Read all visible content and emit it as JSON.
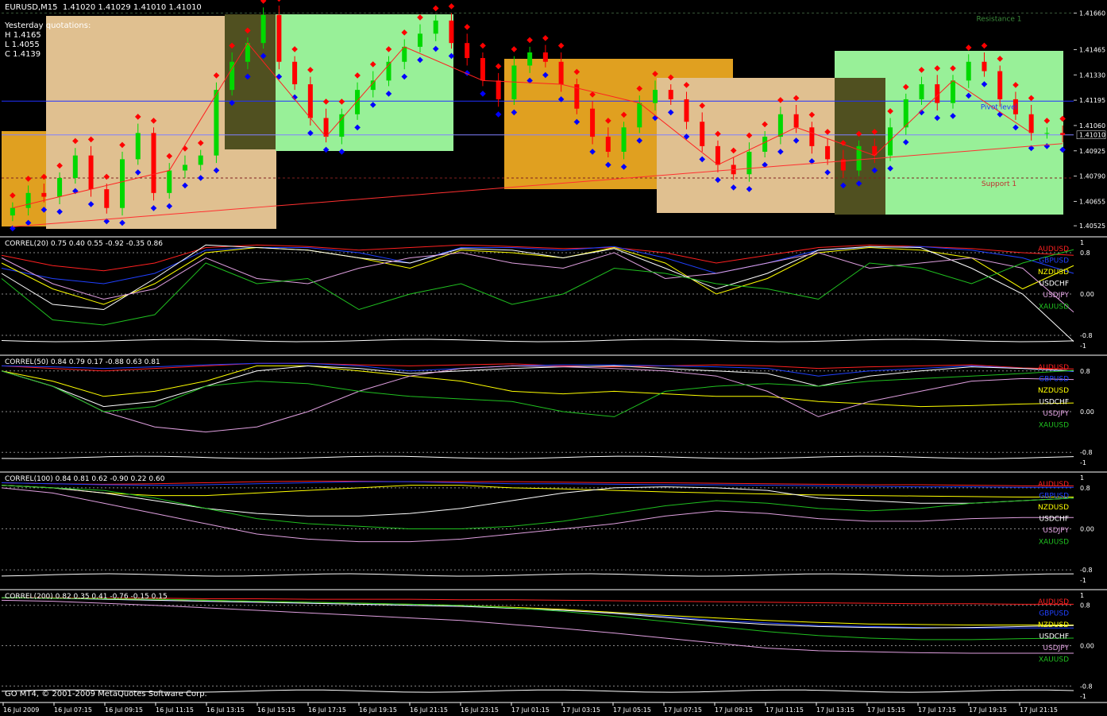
{
  "header": {
    "symbol_line": "EURUSD,M15  1.41020 1.41029 1.41010 1.41010",
    "yesterday_title": "Yesterday quotations:",
    "high": "H 1.4165",
    "low": "L 1.4055",
    "close": "C 1.4139"
  },
  "copyright": "GO MT4, © 2001-2009 MetaQuotes Software Corp.",
  "colors": {
    "background": "#000000",
    "bull": "#00d800",
    "bear": "#ff0000",
    "resistance_dots": "#ff0000",
    "support_dots": "#0000ff",
    "box_tan": "#e0c090",
    "box_green": "#98f098",
    "box_orange": "#e0a020",
    "box_blue": "#0018b0",
    "box_olive": "#505020",
    "AUDUSD": "#ff2020",
    "GBPUSD": "#2040ff",
    "NZDUSD": "#ffff00",
    "USDCHF": "#ffffff",
    "USDJPY": "#e0a0e0",
    "XAUUSD": "#20c020"
  },
  "time_axis": [
    "16 Jul 2009",
    "16 Jul 07:15",
    "16 Jul 09:15",
    "16 Jul 11:15",
    "16 Jul 13:15",
    "16 Jul 15:15",
    "16 Jul 17:15",
    "16 Jul 19:15",
    "16 Jul 21:15",
    "16 Jul 23:15",
    "17 Jul 01:15",
    "17 Jul 03:15",
    "17 Jul 05:15",
    "17 Jul 07:15",
    "17 Jul 09:15",
    "17 Jul 11:15",
    "17 Jul 13:15",
    "17 Jul 15:15",
    "17 Jul 17:15",
    "17 Jul 19:15",
    "17 Jul 21:15"
  ],
  "chart_data": [
    {
      "type": "candlestick",
      "title": "EURUSD,M15",
      "yaxis_ticks": [
        "1.41660",
        "1.41465",
        "1.41330",
        "1.41195",
        "1.41060",
        "1.40925",
        "1.40790",
        "1.40655",
        "1.40525"
      ],
      "ylim": [
        1.405,
        1.417
      ],
      "current_price": "1.41010",
      "annotations": [
        "Resistance 1",
        "Pivot level",
        "Support 1"
      ],
      "levels": {
        "resistance_1": 1.4166,
        "pivot": 1.4119,
        "support_1": 1.4078
      },
      "close_path": [
        1.4062,
        1.407,
        1.4068,
        1.4078,
        1.409,
        1.4072,
        1.4062,
        1.4088,
        1.4102,
        1.407,
        1.4082,
        1.4085,
        1.409,
        1.4125,
        1.414,
        1.415,
        1.4165,
        1.414,
        1.4128,
        1.411,
        1.41,
        1.4112,
        1.4125,
        1.413,
        1.414,
        1.4148,
        1.4155,
        1.4162,
        1.415,
        1.4142,
        1.413,
        1.412,
        1.4138,
        1.4145,
        1.414,
        1.4128,
        1.4115,
        1.41,
        1.4092,
        1.4105,
        1.4118,
        1.4125,
        1.412,
        1.4108,
        1.4095,
        1.4085,
        1.408,
        1.4092,
        1.41,
        1.4112,
        1.4105,
        1.4095,
        1.4088,
        1.4082,
        1.4095,
        1.409,
        1.4105,
        1.412,
        1.4128,
        1.4118,
        1.413,
        1.414,
        1.4135,
        1.412,
        1.4112,
        1.4102,
        1.4102,
        1.4101
      ]
    },
    {
      "type": "line",
      "title": "CORREL(20) 0.75 0.40 0.55 -0.92 -0.35 0.86",
      "period": 20,
      "yaxis_ticks": [
        "1",
        "0.8",
        "0.00",
        "-0.8",
        "-1"
      ],
      "ylim": [
        -1,
        1
      ],
      "series": [
        {
          "name": "AUDUSD",
          "values": [
            0.75,
            0.55,
            0.45,
            0.6,
            0.9,
            0.95,
            0.92,
            0.85,
            0.9,
            0.95,
            0.92,
            0.88,
            0.9,
            0.8,
            0.6,
            0.75,
            0.9,
            0.95,
            0.92,
            0.88,
            0.8,
            0.75
          ]
        },
        {
          "name": "GBPUSD",
          "values": [
            0.5,
            0.3,
            0.2,
            0.4,
            0.85,
            0.9,
            0.9,
            0.8,
            0.6,
            0.9,
            0.9,
            0.85,
            0.92,
            0.7,
            0.4,
            0.6,
            0.85,
            0.9,
            0.92,
            0.85,
            0.7,
            0.4
          ]
        },
        {
          "name": "NZDUSD",
          "values": [
            0.6,
            0.1,
            -0.2,
            0.2,
            0.8,
            0.9,
            0.85,
            0.7,
            0.5,
            0.85,
            0.8,
            0.7,
            0.9,
            0.6,
            0.0,
            0.3,
            0.8,
            0.9,
            0.85,
            0.7,
            0.1,
            0.55
          ]
        },
        {
          "name": "USDCHF",
          "values": [
            0.4,
            -0.2,
            -0.3,
            0.3,
            0.95,
            0.9,
            0.85,
            0.7,
            0.6,
            0.88,
            0.85,
            0.7,
            0.88,
            0.5,
            0.1,
            0.4,
            0.85,
            0.92,
            0.9,
            0.5,
            0.0,
            -0.92
          ]
        },
        {
          "name": "USDJPY",
          "values": [
            0.7,
            0.2,
            -0.1,
            0.1,
            0.7,
            0.3,
            0.2,
            0.5,
            0.7,
            0.8,
            0.6,
            0.5,
            0.8,
            0.3,
            0.4,
            0.6,
            0.8,
            0.5,
            0.6,
            0.7,
            0.5,
            -0.35
          ]
        },
        {
          "name": "XAUUSD",
          "values": [
            0.3,
            -0.5,
            -0.6,
            -0.4,
            0.6,
            0.2,
            0.3,
            -0.3,
            0.0,
            0.2,
            -0.2,
            0.0,
            0.5,
            0.4,
            0.2,
            0.1,
            -0.1,
            0.6,
            0.5,
            0.2,
            0.6,
            0.86
          ]
        }
      ]
    },
    {
      "type": "line",
      "title": "CORREL(50) 0.84 0.79 0.17 -0.88 0.63 0.81",
      "period": 50,
      "yaxis_ticks": [
        "0.8",
        "0.00",
        "-0.8",
        "-1"
      ],
      "ylim": [
        -1,
        1
      ],
      "series": [
        {
          "name": "AUDUSD",
          "values": [
            0.9,
            0.85,
            0.8,
            0.85,
            0.9,
            0.95,
            0.95,
            0.92,
            0.9,
            0.92,
            0.94,
            0.9,
            0.88,
            0.9,
            0.92,
            0.9,
            0.85,
            0.88,
            0.9,
            0.92,
            0.86,
            0.84
          ]
        },
        {
          "name": "GBPUSD",
          "values": [
            0.9,
            0.88,
            0.85,
            0.88,
            0.92,
            0.95,
            0.95,
            0.9,
            0.8,
            0.85,
            0.9,
            0.92,
            0.92,
            0.9,
            0.88,
            0.85,
            0.7,
            0.8,
            0.85,
            0.9,
            0.85,
            0.79
          ]
        },
        {
          "name": "NZDUSD",
          "values": [
            0.8,
            0.6,
            0.3,
            0.4,
            0.6,
            0.9,
            0.9,
            0.8,
            0.7,
            0.6,
            0.4,
            0.35,
            0.4,
            0.35,
            0.3,
            0.3,
            0.2,
            0.15,
            0.1,
            0.12,
            0.15,
            0.17
          ]
        },
        {
          "name": "USDCHF",
          "values": [
            0.8,
            0.5,
            0.1,
            0.2,
            0.5,
            0.8,
            0.9,
            0.85,
            0.75,
            0.8,
            0.85,
            0.88,
            0.9,
            0.85,
            0.8,
            0.75,
            0.5,
            0.7,
            0.8,
            0.88,
            0.85,
            0.8
          ]
        },
        {
          "name": "USDJPY",
          "values": [
            0.8,
            0.5,
            0.0,
            -0.3,
            -0.4,
            -0.3,
            0.0,
            0.4,
            0.7,
            0.85,
            0.9,
            0.88,
            0.85,
            0.8,
            0.7,
            0.4,
            -0.1,
            0.2,
            0.4,
            0.6,
            0.65,
            0.63
          ]
        },
        {
          "name": "XAUUSD",
          "values": [
            0.8,
            0.5,
            0.0,
            0.1,
            0.5,
            0.6,
            0.55,
            0.4,
            0.3,
            0.25,
            0.2,
            0.0,
            -0.1,
            0.4,
            0.5,
            0.55,
            0.5,
            0.6,
            0.65,
            0.7,
            0.75,
            0.81
          ]
        }
      ]
    },
    {
      "type": "line",
      "title": "CORREL(100) 0.84 0.81 0.62 -0.90 0.22 0.60",
      "period": 100,
      "yaxis_ticks": [
        "1",
        "0.8",
        "0.00",
        "-0.8",
        "-1"
      ],
      "ylim": [
        -1,
        1
      ],
      "series": [
        {
          "name": "AUDUSD",
          "values": [
            0.9,
            0.88,
            0.87,
            0.88,
            0.9,
            0.92,
            0.93,
            0.93,
            0.92,
            0.92,
            0.92,
            0.91,
            0.9,
            0.9,
            0.89,
            0.88,
            0.87,
            0.86,
            0.86,
            0.85,
            0.84,
            0.84
          ]
        },
        {
          "name": "GBPUSD",
          "values": [
            0.9,
            0.88,
            0.86,
            0.85,
            0.86,
            0.88,
            0.9,
            0.92,
            0.92,
            0.9,
            0.88,
            0.88,
            0.87,
            0.86,
            0.86,
            0.85,
            0.84,
            0.83,
            0.82,
            0.82,
            0.81,
            0.81
          ]
        },
        {
          "name": "NZDUSD",
          "values": [
            0.85,
            0.8,
            0.7,
            0.65,
            0.65,
            0.7,
            0.75,
            0.8,
            0.85,
            0.85,
            0.8,
            0.78,
            0.75,
            0.72,
            0.7,
            0.68,
            0.66,
            0.65,
            0.64,
            0.63,
            0.62,
            0.62
          ]
        },
        {
          "name": "USDCHF",
          "values": [
            0.85,
            0.8,
            0.7,
            0.55,
            0.4,
            0.3,
            0.25,
            0.25,
            0.3,
            0.4,
            0.55,
            0.7,
            0.8,
            0.82,
            0.8,
            0.75,
            0.6,
            0.55,
            0.5,
            0.5,
            0.55,
            0.6
          ]
        },
        {
          "name": "USDJPY",
          "values": [
            0.8,
            0.7,
            0.5,
            0.3,
            0.1,
            -0.1,
            -0.2,
            -0.25,
            -0.25,
            -0.2,
            -0.1,
            0.0,
            0.1,
            0.25,
            0.35,
            0.3,
            0.2,
            0.15,
            0.15,
            0.2,
            0.22,
            0.22
          ]
        },
        {
          "name": "XAUUSD",
          "values": [
            0.85,
            0.8,
            0.75,
            0.6,
            0.4,
            0.2,
            0.1,
            0.05,
            0.0,
            0.0,
            0.05,
            0.15,
            0.3,
            0.45,
            0.55,
            0.5,
            0.4,
            0.35,
            0.4,
            0.5,
            0.55,
            0.6
          ]
        }
      ]
    },
    {
      "type": "line",
      "title": "CORREL(200) 0.82 0.35 0.41 -0.76 -0.15 0.15",
      "period": 200,
      "yaxis_ticks": [
        "1",
        "0.8",
        "0.00",
        "-0.8",
        "-1"
      ],
      "ylim": [
        -1,
        1
      ],
      "series": [
        {
          "name": "AUDUSD",
          "values": [
            0.95,
            0.95,
            0.94,
            0.94,
            0.93,
            0.93,
            0.92,
            0.92,
            0.92,
            0.91,
            0.91,
            0.9,
            0.89,
            0.88,
            0.87,
            0.86,
            0.85,
            0.84,
            0.83,
            0.83,
            0.82,
            0.82
          ]
        },
        {
          "name": "GBPUSD",
          "values": [
            0.95,
            0.94,
            0.92,
            0.9,
            0.88,
            0.86,
            0.84,
            0.82,
            0.8,
            0.78,
            0.75,
            0.7,
            0.65,
            0.58,
            0.5,
            0.45,
            0.4,
            0.38,
            0.36,
            0.35,
            0.35,
            0.35
          ]
        },
        {
          "name": "NZDUSD",
          "values": [
            0.95,
            0.94,
            0.93,
            0.92,
            0.9,
            0.88,
            0.86,
            0.84,
            0.82,
            0.8,
            0.76,
            0.72,
            0.66,
            0.6,
            0.55,
            0.5,
            0.46,
            0.43,
            0.42,
            0.41,
            0.41,
            0.41
          ]
        },
        {
          "name": "USDCHF",
          "values": [
            0.95,
            0.94,
            0.92,
            0.9,
            0.88,
            0.86,
            0.84,
            0.82,
            0.8,
            0.78,
            0.74,
            0.7,
            0.64,
            0.56,
            0.48,
            0.42,
            0.38,
            0.36,
            0.35,
            0.36,
            0.38,
            0.4
          ]
        },
        {
          "name": "USDJPY",
          "values": [
            0.9,
            0.88,
            0.84,
            0.8,
            0.75,
            0.7,
            0.65,
            0.6,
            0.55,
            0.5,
            0.42,
            0.34,
            0.25,
            0.15,
            0.05,
            -0.05,
            -0.1,
            -0.12,
            -0.14,
            -0.15,
            -0.15,
            -0.15
          ]
        },
        {
          "name": "XAUUSD",
          "values": [
            0.95,
            0.94,
            0.93,
            0.92,
            0.9,
            0.88,
            0.86,
            0.84,
            0.82,
            0.8,
            0.75,
            0.68,
            0.58,
            0.48,
            0.38,
            0.28,
            0.2,
            0.15,
            0.12,
            0.12,
            0.14,
            0.15
          ]
        }
      ]
    }
  ]
}
